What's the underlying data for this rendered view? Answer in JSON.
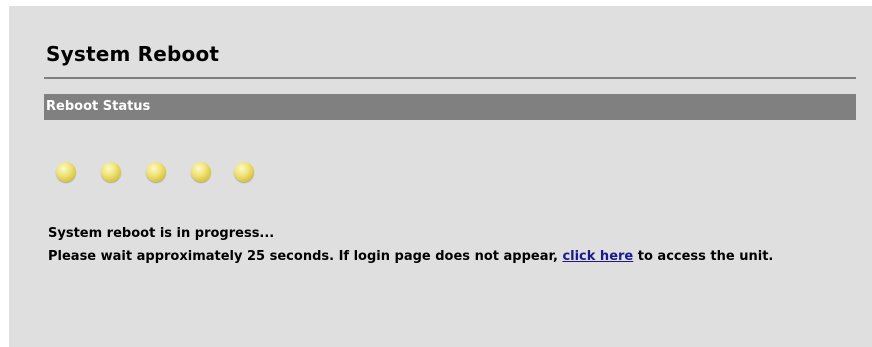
{
  "page": {
    "title": "System Reboot"
  },
  "section": {
    "header": "Reboot Status"
  },
  "progress": {
    "indicator_icons": [
      "yellow-dot-icon",
      "yellow-dot-icon",
      "yellow-dot-icon",
      "yellow-dot-icon",
      "yellow-dot-icon"
    ],
    "dot_color": "#e6d45a"
  },
  "messages": {
    "status": "System reboot is in progress...",
    "wait_before_link": "Please wait approximately 25 seconds. If login page does not appear, ",
    "link_label": "click here",
    "wait_after_link": " to access the unit."
  },
  "colors": {
    "background": "#dfdfdf",
    "bar": "#808080",
    "link": "#1a1a8c"
  }
}
